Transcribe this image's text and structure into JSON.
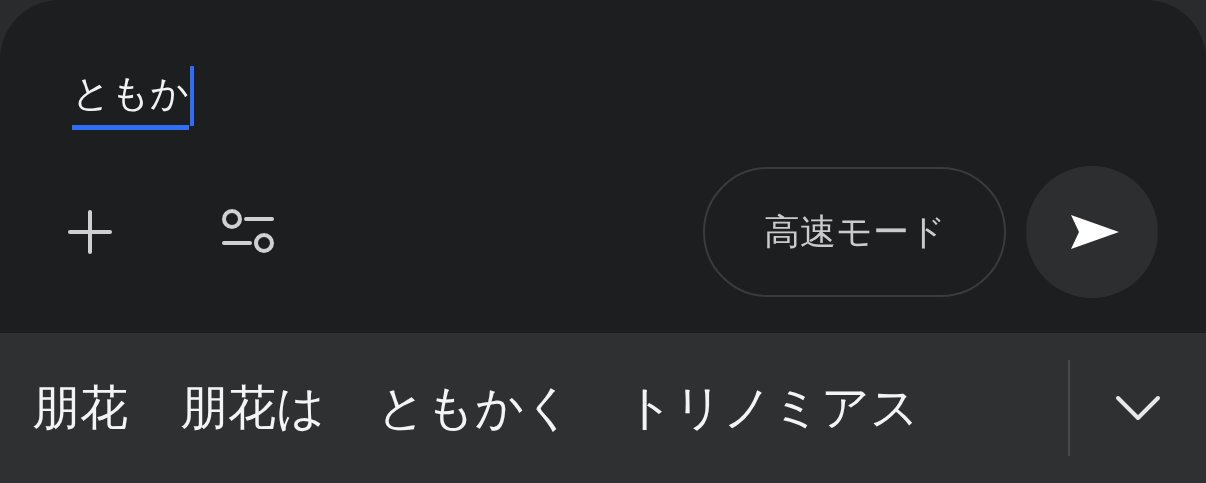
{
  "composer": {
    "input": {
      "value": "ともか",
      "composing": true
    },
    "mode_button": {
      "label": "高速モード"
    }
  },
  "candidates": [
    {
      "text": "朋花"
    },
    {
      "text": "朋花は"
    },
    {
      "text": "ともかく"
    },
    {
      "text": "トリノミアス"
    }
  ]
}
